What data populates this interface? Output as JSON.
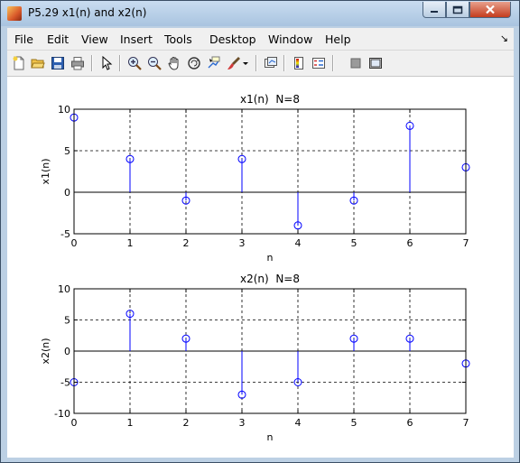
{
  "window": {
    "title": "P5.29 x1(n) and x2(n)"
  },
  "menu": [
    "File",
    "Edit",
    "View",
    "Insert",
    "Tools",
    "Desktop",
    "Window",
    "Help"
  ],
  "toolbar": {
    "icons": [
      "new-figure-icon",
      "open-file-icon",
      "save-icon",
      "print-icon",
      "pointer-icon",
      "zoom-in-icon",
      "zoom-out-icon",
      "pan-icon",
      "rotate-3d-icon",
      "data-cursor-icon",
      "brush-icon",
      "dropdown-arrow-icon",
      "link-plot-icon",
      "colorbar-icon",
      "legend-icon",
      "hide-plot-tools-icon",
      "show-plot-tools-icon"
    ]
  },
  "colors": {
    "stem": "#0000ff",
    "axes_bg": "#ffffff",
    "grid": "#000000"
  },
  "chart_data": [
    {
      "type": "scatter",
      "subtype": "stem",
      "title": "x1(n)  N=8",
      "xlabel": "n",
      "ylabel": "x1(n)",
      "x": [
        0,
        1,
        2,
        3,
        4,
        5,
        6,
        7
      ],
      "values": [
        9,
        4,
        -1,
        4,
        -4,
        -1,
        8,
        3
      ],
      "xlim": [
        0,
        7
      ],
      "ylim": [
        -5,
        10
      ],
      "xticks": [
        "0",
        "1",
        "2",
        "3",
        "4",
        "5",
        "6",
        "7"
      ],
      "yticks": [
        "-5",
        "0",
        "5",
        "10"
      ],
      "grid": true
    },
    {
      "type": "scatter",
      "subtype": "stem",
      "title": "x2(n)  N=8",
      "xlabel": "n",
      "ylabel": "x2(n)",
      "x": [
        0,
        1,
        2,
        3,
        4,
        5,
        6,
        7
      ],
      "values": [
        -5,
        6,
        2,
        -7,
        -5,
        2,
        2,
        -2
      ],
      "xlim": [
        0,
        7
      ],
      "ylim": [
        -10,
        10
      ],
      "xticks": [
        "0",
        "1",
        "2",
        "3",
        "4",
        "5",
        "6",
        "7"
      ],
      "yticks": [
        "-10",
        "-5",
        "0",
        "5",
        "10"
      ],
      "grid": true
    }
  ]
}
